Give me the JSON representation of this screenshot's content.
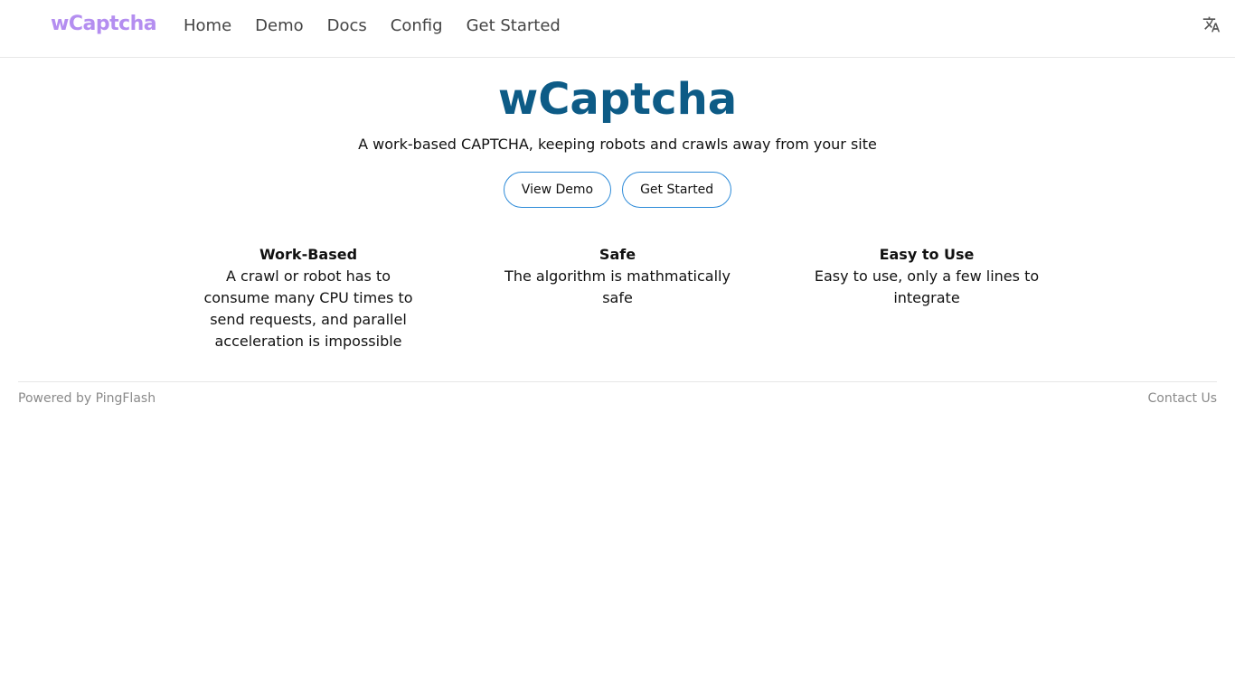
{
  "navbar": {
    "logo": "wCaptcha",
    "links": [
      "Home",
      "Demo",
      "Docs",
      "Config",
      "Get Started"
    ],
    "language_icon": "translate-icon"
  },
  "hero": {
    "title": "wCaptcha",
    "subtitle": "A work-based CAPTCHA, keeping robots and crawls away from your site",
    "buttons": [
      "View Demo",
      "Get Started"
    ]
  },
  "features": [
    {
      "title": "Work-Based",
      "description": "A crawl or robot has to consume many CPU times to send requests, and parallel acceleration is impossible"
    },
    {
      "title": "Safe",
      "description": "The algorithm is mathmatically safe"
    },
    {
      "title": "Easy to Use",
      "description": "Easy to use, only a few lines to integrate"
    }
  ],
  "footer": {
    "left": "Powered by PingFlash",
    "right": "Contact Us"
  },
  "colors": {
    "logo": "#b48ef0",
    "title": "#0d5b86",
    "button_border": "#2c8ad8",
    "muted_text": "#8a8a8a"
  }
}
